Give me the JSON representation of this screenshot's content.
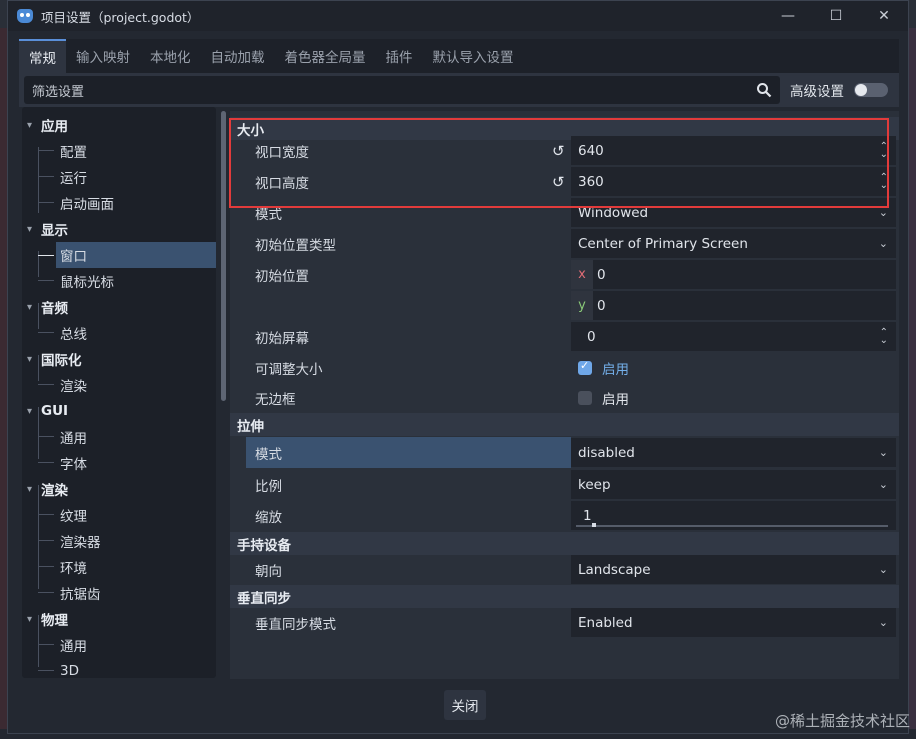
{
  "window": {
    "title": "项目设置（project.godot）",
    "controls": {
      "minimize": "—",
      "maximize": "☐",
      "close": "✕"
    }
  },
  "tabs": [
    {
      "label": "常规",
      "active": true
    },
    {
      "label": "输入映射"
    },
    {
      "label": "本地化"
    },
    {
      "label": "自动加载"
    },
    {
      "label": "着色器全局量"
    },
    {
      "label": "插件"
    },
    {
      "label": "默认导入设置"
    }
  ],
  "toolbar": {
    "filter_placeholder": "筛选设置",
    "advanced_label": "高级设置",
    "advanced_enabled": false
  },
  "tree": {
    "categories": [
      {
        "label": "应用",
        "children": [
          "配置",
          "运行",
          "启动画面"
        ]
      },
      {
        "label": "显示",
        "children": [
          "窗口",
          "鼠标光标"
        ],
        "selected_child": "窗口"
      },
      {
        "label": "音频",
        "children": [
          "总线"
        ]
      },
      {
        "label": "国际化",
        "children": [
          "渲染"
        ]
      },
      {
        "label": "GUI",
        "children": [
          "通用",
          "字体"
        ]
      },
      {
        "label": "渲染",
        "children": [
          "纹理",
          "渲染器",
          "环境",
          "抗锯齿"
        ]
      },
      {
        "label": "物理",
        "children": [
          "通用",
          "3D"
        ]
      }
    ]
  },
  "inspector": {
    "sections": {
      "size": "大小",
      "stretch": "拉伸",
      "handheld": "手持设备",
      "vsync": "垂直同步"
    },
    "viewport_width": {
      "label": "视口宽度",
      "value": "640"
    },
    "viewport_height": {
      "label": "视口高度",
      "value": "360"
    },
    "mode": {
      "label": "模式",
      "value": "Windowed"
    },
    "initial_position_type": {
      "label": "初始位置类型",
      "value": "Center of Primary Screen"
    },
    "initial_position": {
      "label": "初始位置",
      "x_tag": "x",
      "x": "0",
      "y_tag": "y",
      "y": "0"
    },
    "initial_screen": {
      "label": "初始屏幕",
      "value": "0"
    },
    "resizable": {
      "label": "可调整大小",
      "value": "启用",
      "checked": true
    },
    "borderless": {
      "label": "无边框",
      "value": "启用",
      "checked": false
    },
    "stretch_mode": {
      "label": "模式",
      "value": "disabled"
    },
    "aspect": {
      "label": "比例",
      "value": "keep"
    },
    "scale": {
      "label": "缩放",
      "value": "1"
    },
    "orientation": {
      "label": "朝向",
      "value": "Landscape"
    },
    "vsync_mode": {
      "label": "垂直同步模式",
      "value": "Enabled"
    }
  },
  "footer": {
    "close_label": "关闭"
  },
  "watermark": "@稀土掘金技术社区",
  "colors": {
    "accent": "#5a8fd9",
    "selection": "#3a5270",
    "highlight_box": "#e23b3b"
  }
}
